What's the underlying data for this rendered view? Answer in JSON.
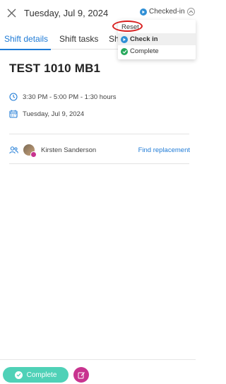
{
  "header": {
    "date_title": "Tuesday, Jul 9, 2024",
    "status_label": "Checked-in"
  },
  "tabs": [
    {
      "label": "Shift details"
    },
    {
      "label": "Shift tasks"
    },
    {
      "label": "Shi"
    }
  ],
  "status_menu": {
    "items": [
      {
        "label": "Reset"
      },
      {
        "label": "Check in"
      },
      {
        "label": "Complete"
      }
    ]
  },
  "shift": {
    "title": "TEST 1010 MB1",
    "time": "3:30 PM - 5:00 PM - 1:30 hours",
    "date": "Tuesday, Jul 9, 2024",
    "assignee": "Kirsten Sanderson",
    "find_replacement": "Find replacement"
  },
  "footer": {
    "complete_label": "Complete"
  },
  "colors": {
    "accent_blue": "#1f7bd6",
    "complete_teal": "#4fd1b7",
    "edit_magenta": "#c8338f",
    "checked_in_blue": "#2f8fd5",
    "complete_green": "#25a85b",
    "highlight_red": "#d81e1e"
  },
  "icons": {
    "close": "close-icon",
    "clock": "clock-icon",
    "calendar": "calendar-icon",
    "people": "people-icon",
    "edit": "edit-icon"
  }
}
